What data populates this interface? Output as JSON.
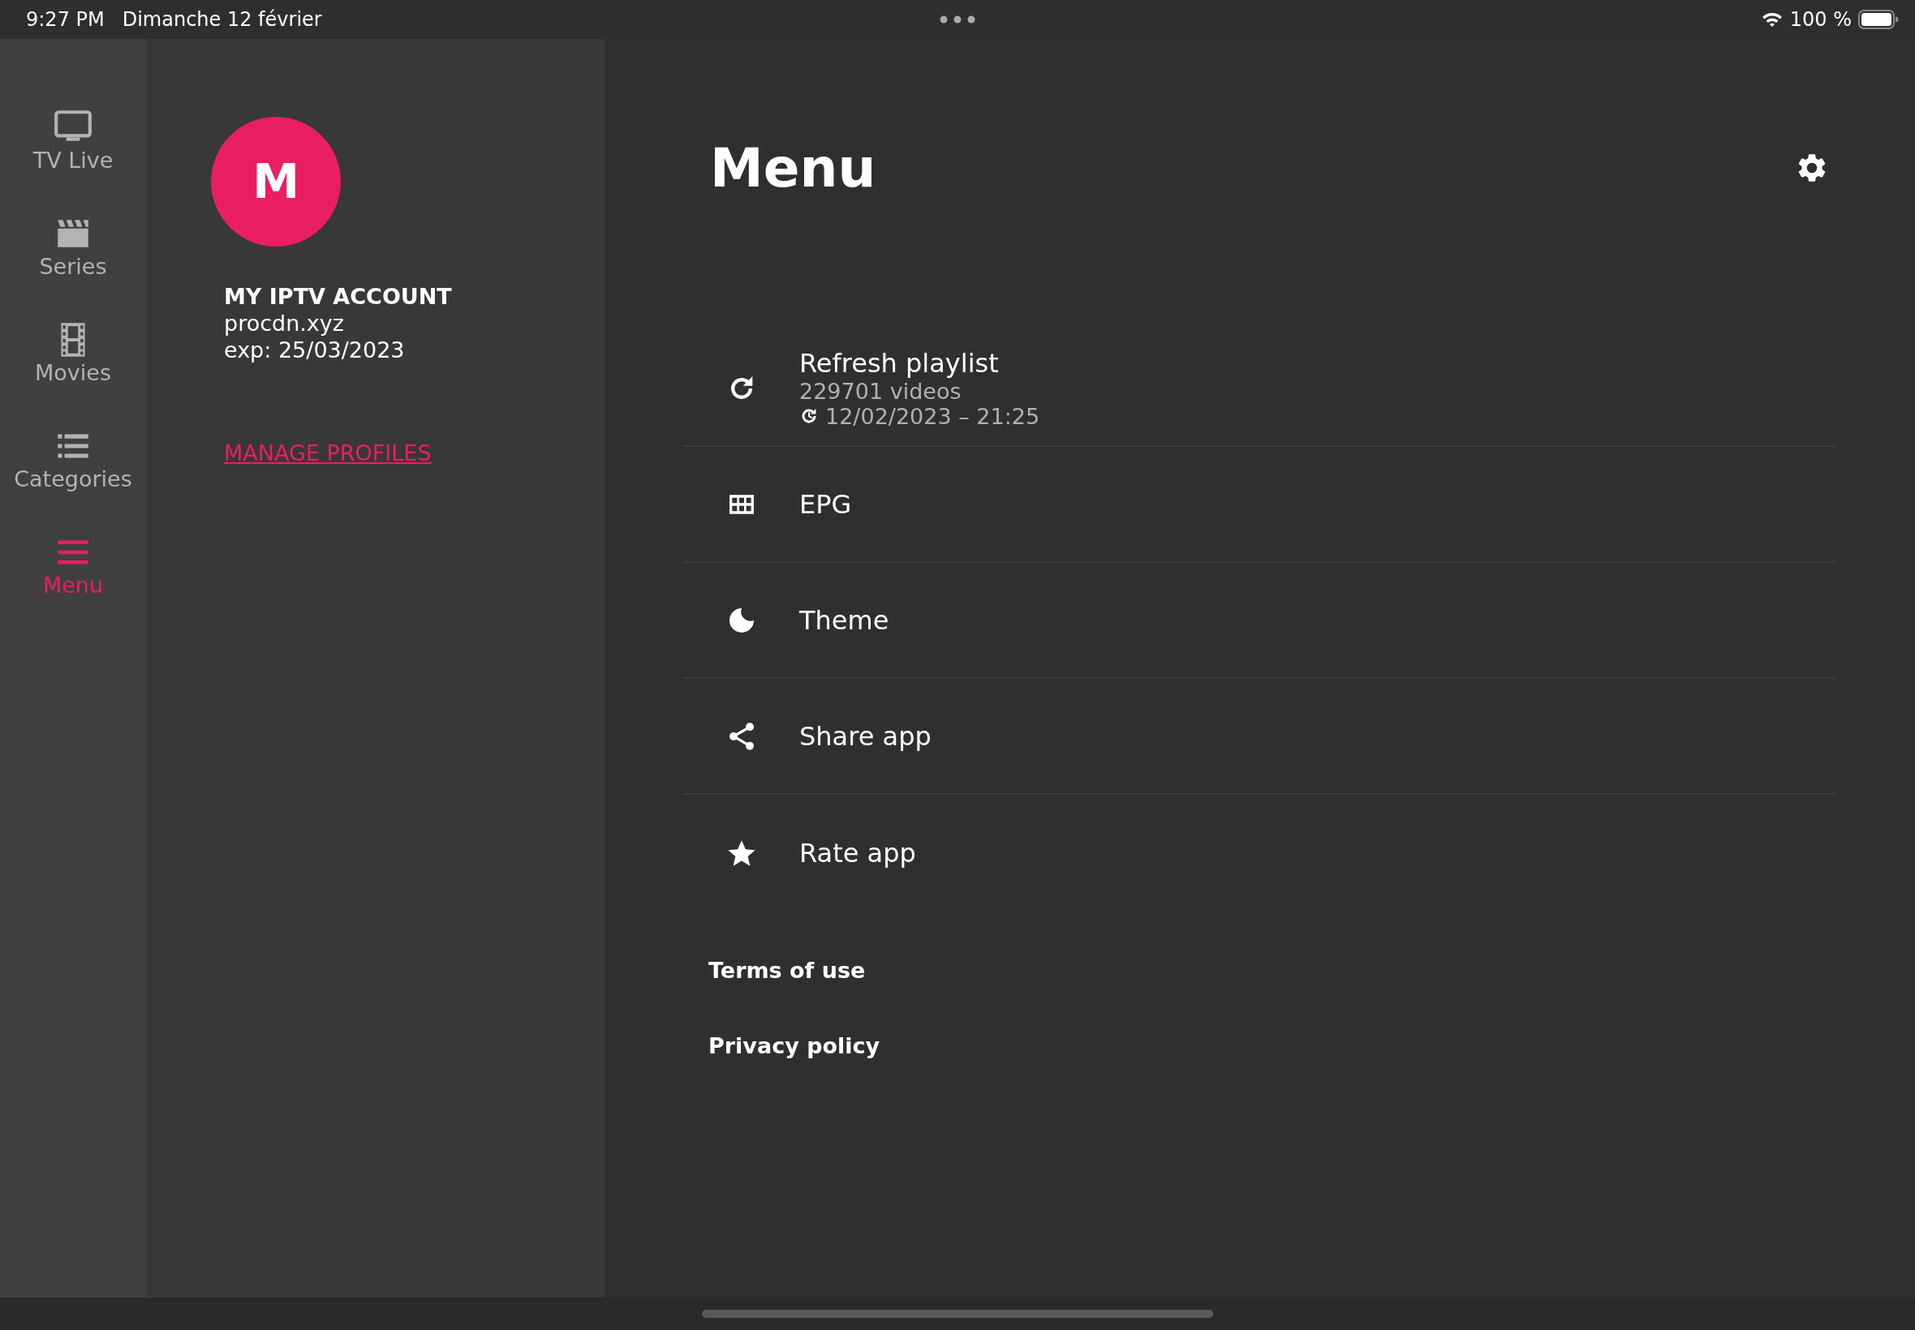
{
  "status_bar": {
    "time": "9:27 PM",
    "date": "Dimanche 12 février",
    "battery": "100 %"
  },
  "nav_rail": {
    "items": [
      {
        "label": "TV Live",
        "selected": false
      },
      {
        "label": "Series",
        "selected": false
      },
      {
        "label": "Movies",
        "selected": false
      },
      {
        "label": "Categories",
        "selected": false
      },
      {
        "label": "Menu",
        "selected": true
      }
    ]
  },
  "profile": {
    "avatar_letter": "M",
    "name": "MY IPTV ACCOUNT",
    "server": "procdn.xyz",
    "expiry": "exp: 25/03/2023",
    "manage_link": "MANAGE PROFILES"
  },
  "main": {
    "title": "Menu",
    "menu_items": [
      {
        "label": "Refresh playlist",
        "subtitle": "229701 videos",
        "updated": "12/02/2023 – 21:25"
      },
      {
        "label": "EPG"
      },
      {
        "label": "Theme"
      },
      {
        "label": "Share app"
      },
      {
        "label": "Rate app"
      }
    ],
    "links": [
      "Terms of use",
      "Privacy policy"
    ]
  }
}
